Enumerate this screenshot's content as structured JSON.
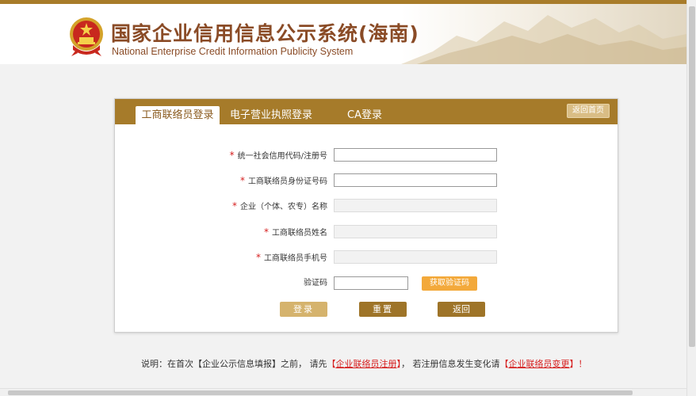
{
  "header": {
    "title_cn": "国家企业信用信息公示系统(海南)",
    "title_en": "National Enterprise Credit Information Publicity System"
  },
  "tabs": [
    {
      "label": "工商联络员登录",
      "active": true
    },
    {
      "label": "电子营业执照登录",
      "active": false
    },
    {
      "label": "CA登录",
      "active": false
    }
  ],
  "home_button": "返回首页",
  "form": {
    "required_mark": "*",
    "fields": [
      {
        "label": "统一社会信用代码/注册号",
        "required": true,
        "value": "",
        "disabled": false
      },
      {
        "label": "工商联络员身份证号码",
        "required": true,
        "value": "",
        "disabled": false
      },
      {
        "label": "企业（个体、农专）名称",
        "required": true,
        "value": "",
        "disabled": true
      },
      {
        "label": "工商联络员姓名",
        "required": true,
        "value": "",
        "disabled": true
      },
      {
        "label": "工商联络员手机号",
        "required": true,
        "value": "",
        "disabled": true
      }
    ],
    "captcha": {
      "label": "验证码",
      "value": "",
      "button": "获取验证码"
    }
  },
  "buttons": {
    "login": "登录",
    "reset": "重置",
    "back": "返回"
  },
  "note": {
    "prefix": "说明：在首次【企业公示信息填报】之前， 请先",
    "link1_open": "【",
    "link1": "企业联络员注册",
    "link1_close": "】",
    "middle": "， 若注册信息发生变化请",
    "link2_open": "【",
    "link2": "企业联络员变更",
    "link2_close": "】",
    "suffix": "！"
  },
  "colors": {
    "brand": "#a67b2a",
    "title": "#8a4b26",
    "required": "#d61f1f",
    "captcha_button": "#f3a93b"
  }
}
